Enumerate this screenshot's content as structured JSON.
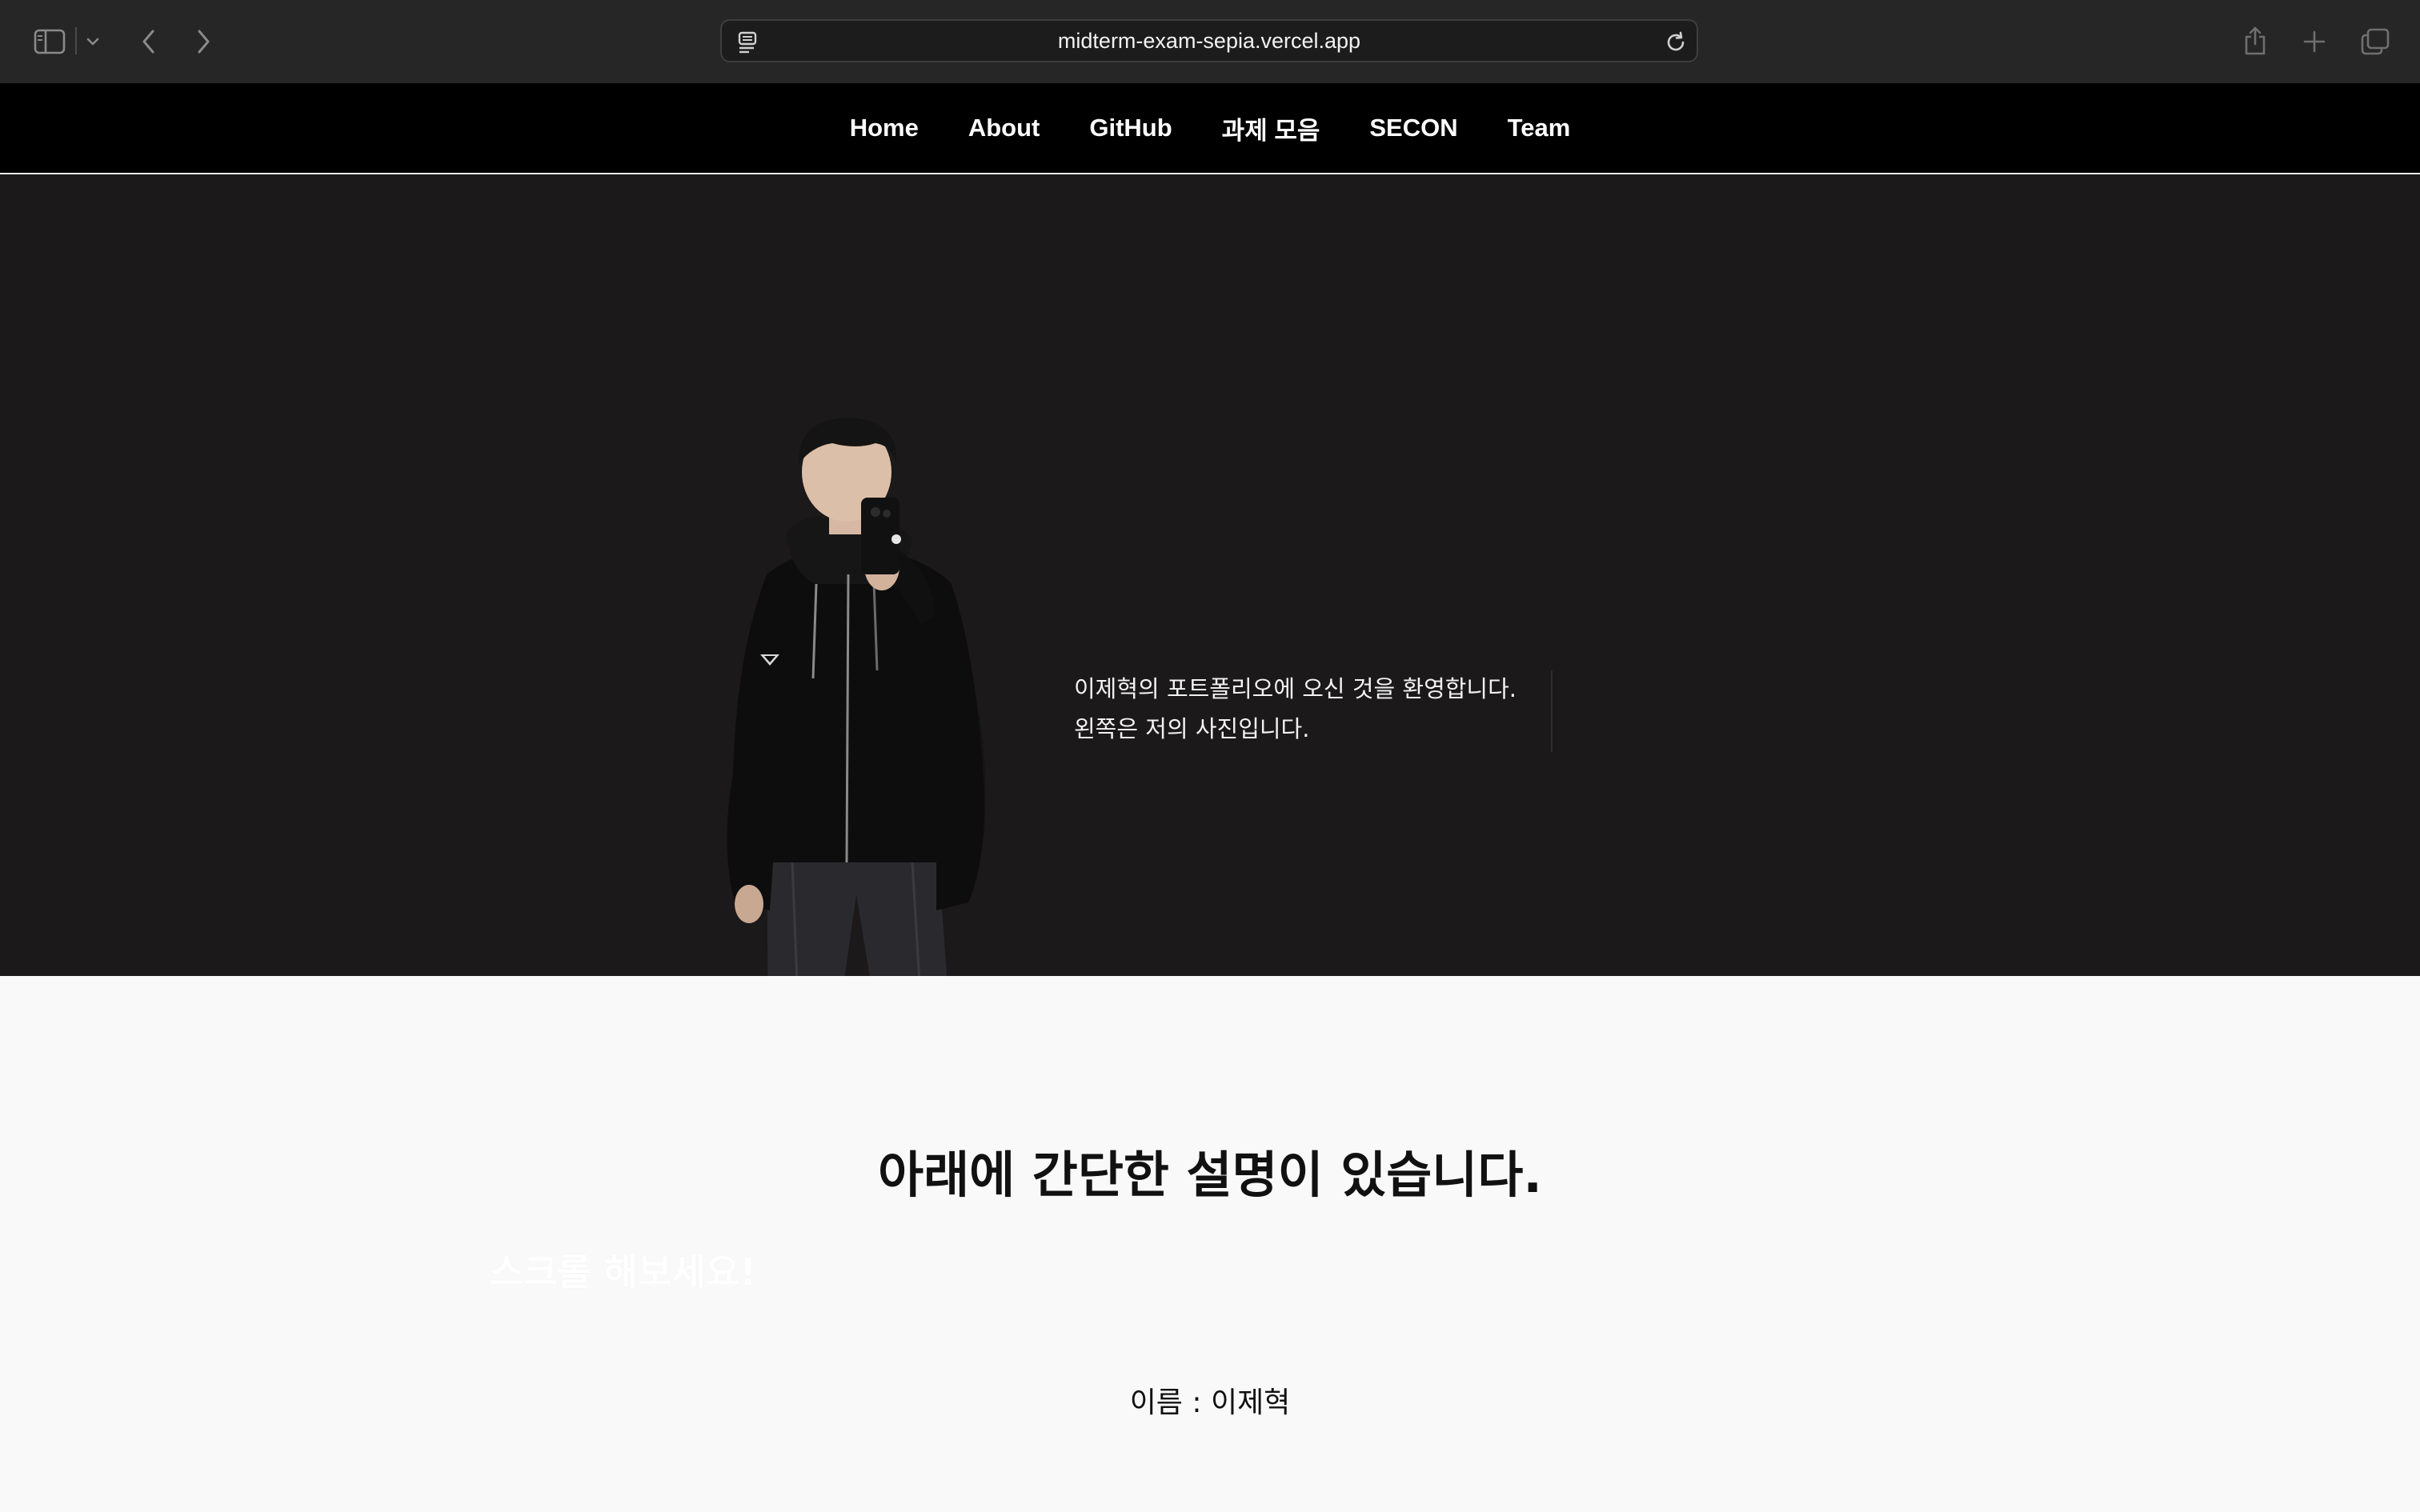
{
  "browser": {
    "url": "midterm-exam-sepia.vercel.app",
    "icons": [
      "sidebar-icon",
      "chevron-down-icon",
      "back-arrow-icon",
      "forward-arrow-icon",
      "page-icon",
      "reload-icon",
      "share-icon",
      "plus-icon",
      "tabs-icon"
    ]
  },
  "nav": {
    "items": [
      {
        "label": "Home"
      },
      {
        "label": "About"
      },
      {
        "label": "GitHub"
      },
      {
        "label": "과제 모음"
      },
      {
        "label": "SECON"
      },
      {
        "label": "Team"
      }
    ]
  },
  "hero": {
    "line1": "이제혁의 포트폴리오에 오신 것을 환영합니다.",
    "line2": "왼쪽은 저의 사진입니다."
  },
  "about": {
    "heading": "아래에 간단한 설명이 있습니다.",
    "scroll_hint": "스크롤 해보세요!",
    "name_line": "이름 : 이제혁"
  },
  "colors": {
    "chrome_bg": "#262626",
    "nav_bg": "#000000",
    "hero_bg": "#1b191a",
    "page_bg": "#f9f9f9"
  }
}
